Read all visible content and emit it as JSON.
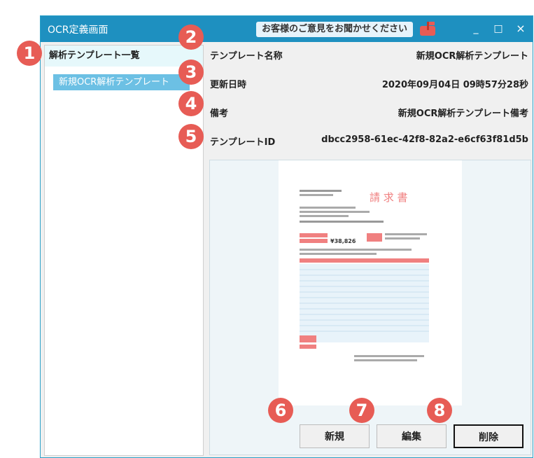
{
  "window": {
    "title": "OCR定義画面",
    "feedback": "お客様のご意見をお聞かせください",
    "controls": [
      "_",
      "□",
      "×"
    ]
  },
  "left_panel": {
    "header": "解析テンプレート一覧",
    "items": [
      {
        "label": "新規OCR解析テンプレート",
        "selected": true
      }
    ]
  },
  "details": {
    "fields": [
      {
        "label": "テンプレート名称",
        "value": "新規OCR解析テンプレート"
      },
      {
        "label": "更新日時",
        "value": "2020年09月04日 09時57分28秒"
      },
      {
        "label": "備考",
        "value": "新規OCR解析テンプレート備考"
      },
      {
        "label": "テンプレートID",
        "value": "dbcc2958-61ec-42f8-82a2-e6cf63f81d5b"
      }
    ]
  },
  "preview": {
    "heading": "請 求 書",
    "amount": "¥38,826"
  },
  "actions": {
    "new": "新規",
    "edit": "編集",
    "delete": "削除"
  },
  "badges": [
    "1",
    "2",
    "3",
    "4",
    "5",
    "6",
    "7",
    "8"
  ],
  "colors": {
    "titlebar": "#1e90c0",
    "selected_item": "#6cc0e4",
    "badge": "#e75c55",
    "invoice_accent": "#f08080"
  }
}
